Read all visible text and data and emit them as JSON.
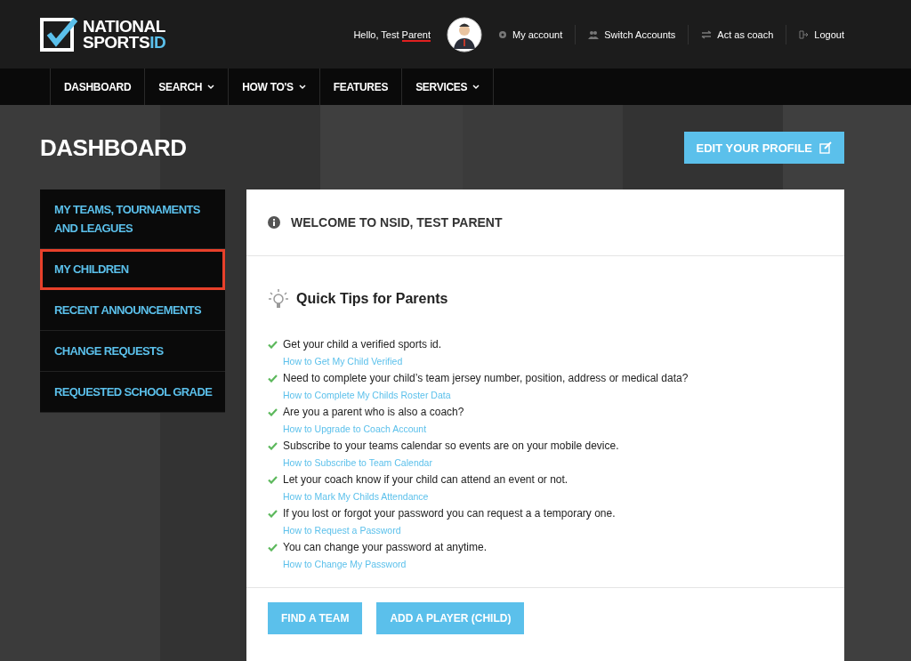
{
  "logo": {
    "line1": "NATIONAL",
    "line2": "SPORTS",
    "line2_accent": "ID"
  },
  "user": {
    "greeting": "Hello, Test",
    "name": "Parent",
    "name_underlined": true
  },
  "top_links": [
    {
      "label": "My account",
      "kind": "gear"
    },
    {
      "label": "Switch Accounts",
      "kind": "users"
    },
    {
      "label": "Act as coach",
      "kind": "swap"
    },
    {
      "label": "Logout",
      "kind": "logout"
    }
  ],
  "nav": [
    {
      "label": "DASHBOARD",
      "dropdown": false
    },
    {
      "label": "SEARCH",
      "dropdown": true
    },
    {
      "label": "HOW TO'S",
      "dropdown": true
    },
    {
      "label": "FEATURES",
      "dropdown": false
    },
    {
      "label": "SERVICES",
      "dropdown": true
    }
  ],
  "page_title": "DASHBOARD",
  "edit_button": "EDIT YOUR PROFILE",
  "sidebar": {
    "items": [
      {
        "label": "MY TEAMS, TOURNAMENTS AND LEAGUES",
        "highlighted": false
      },
      {
        "label": "MY CHILDREN",
        "highlighted": true
      },
      {
        "label": "RECENT ANNOUNCEMENTS",
        "highlighted": false
      },
      {
        "label": "CHANGE REQUESTS",
        "highlighted": false
      },
      {
        "label": "REQUESTED SCHOOL GRADE",
        "highlighted": false
      }
    ]
  },
  "card": {
    "title": "WELCOME TO NSID, TEST PARENT",
    "tips_title": "Quick Tips for Parents",
    "tips": [
      {
        "text": "Get your child a verified sports id.",
        "link": "How to Get My Child Verified"
      },
      {
        "text": "Need to complete your child’s team jersey number, position, address or medical data?",
        "link": "How to Complete My Childs Roster Data"
      },
      {
        "text": "Are you a parent who is also a coach?",
        "link": "How to Upgrade to Coach Account"
      },
      {
        "text": "Subscribe to your teams calendar so events are on your mobile device.",
        "link": "How to Subscribe to Team Calendar"
      },
      {
        "text": "Let your coach know if your child can attend an event or not.",
        "link": "How to Mark My Childs Attendance"
      },
      {
        "text": "If you lost or forgot your password you can request a a temporary one.",
        "link": "How to Request a Password"
      },
      {
        "text": "You can change your password at anytime.",
        "link": "How to Change My Password"
      }
    ],
    "buttons": [
      "FIND A TEAM",
      "ADD A PLAYER (CHILD)"
    ]
  }
}
